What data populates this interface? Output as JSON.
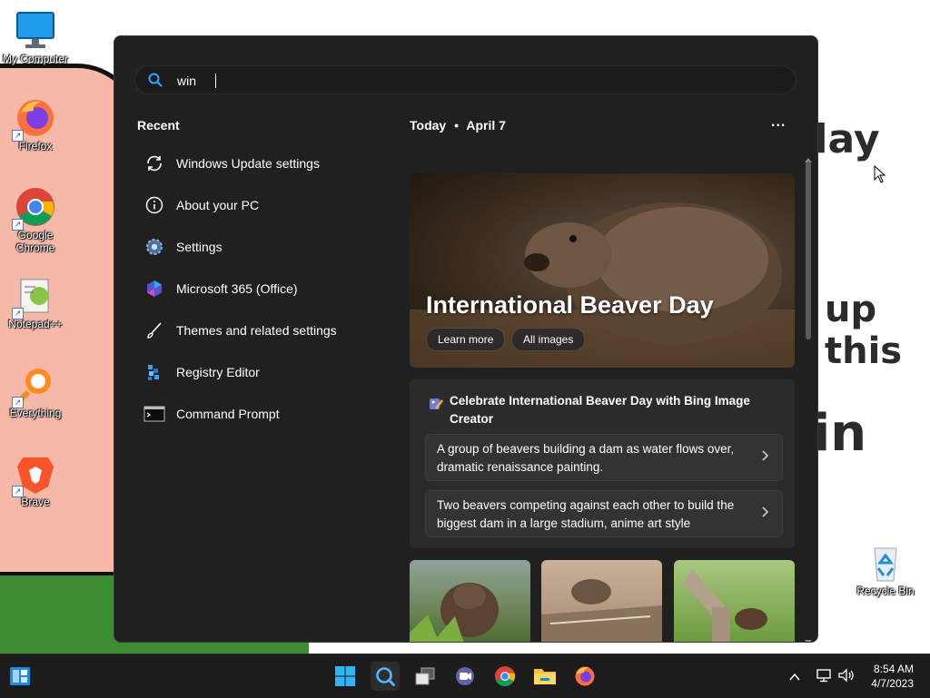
{
  "wallpaper": {
    "texts": [
      "day",
      "up this",
      "in"
    ]
  },
  "desktop_icons": [
    {
      "name": "my-computer",
      "label": "My Computer"
    },
    {
      "name": "firefox",
      "label": "Firefox"
    },
    {
      "name": "google-chrome",
      "label": "Google Chrome"
    },
    {
      "name": "notepad-plus-plus",
      "label": "Notepad++"
    },
    {
      "name": "everything",
      "label": "Everything"
    },
    {
      "name": "brave",
      "label": "Brave"
    },
    {
      "name": "recycle-bin",
      "label": "Recycle Bin"
    }
  ],
  "search": {
    "value": "win"
  },
  "recent": {
    "heading": "Recent",
    "items": [
      {
        "label": "Windows Update settings",
        "icon": "refresh-icon"
      },
      {
        "label": "About your PC",
        "icon": "info-icon"
      },
      {
        "label": "Settings",
        "icon": "gear-icon"
      },
      {
        "label": "Microsoft 365 (Office)",
        "icon": "office-icon"
      },
      {
        "label": "Themes and related settings",
        "icon": "brush-icon"
      },
      {
        "label": "Registry Editor",
        "icon": "registry-icon"
      },
      {
        "label": "Command Prompt",
        "icon": "terminal-icon"
      }
    ]
  },
  "today": {
    "label": "Today",
    "separator": "•",
    "date": "April 7",
    "more": "..."
  },
  "hero": {
    "title": "International Beaver Day",
    "learn_more": "Learn more",
    "all_images": "All images"
  },
  "bing_card": {
    "title": "Celebrate International Beaver Day with Bing Image Creator",
    "prompts": [
      "A group of beavers building a dam as water flows over, dramatic renaissance painting.",
      "Two beavers competing against each other to build the biggest dam in a large stadium, anime art style"
    ]
  },
  "taskbar": {
    "apps": [
      "start",
      "search",
      "task-view",
      "teams",
      "chrome",
      "file-explorer",
      "firefox"
    ],
    "time": "8:54 AM",
    "date": "4/7/2023"
  },
  "colors": {
    "panel_bg": "#202020",
    "accent": "#3aa0ff",
    "taskbar_bg": "#1c1c1c"
  }
}
